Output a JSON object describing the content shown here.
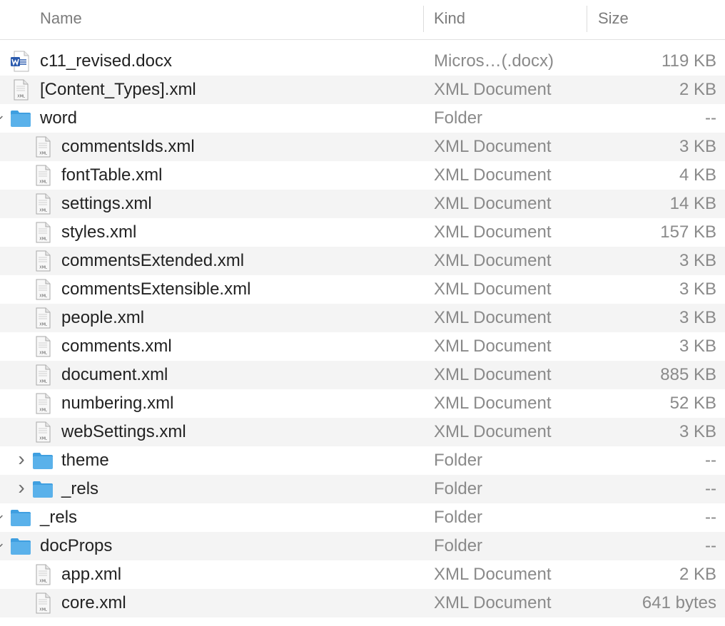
{
  "columns": {
    "name": "Name",
    "kind": "Kind",
    "size": "Size"
  },
  "rows": [
    {
      "name": "c11_revised.docx",
      "kind": "Micros…(.docx)",
      "size": "119 KB",
      "icon": "word-doc-icon",
      "depth": 0,
      "disclosure": "none"
    },
    {
      "name": "[Content_Types].xml",
      "kind": "XML Document",
      "size": "2 KB",
      "icon": "xml-file-icon",
      "depth": 0,
      "disclosure": "none"
    },
    {
      "name": "word",
      "kind": "Folder",
      "size": "--",
      "icon": "folder-icon",
      "depth": 0,
      "disclosure": "expanded"
    },
    {
      "name": "commentsIds.xml",
      "kind": "XML Document",
      "size": "3 KB",
      "icon": "xml-file-icon",
      "depth": 1,
      "disclosure": "none"
    },
    {
      "name": "fontTable.xml",
      "kind": "XML Document",
      "size": "4 KB",
      "icon": "xml-file-icon",
      "depth": 1,
      "disclosure": "none"
    },
    {
      "name": "settings.xml",
      "kind": "XML Document",
      "size": "14 KB",
      "icon": "xml-file-icon",
      "depth": 1,
      "disclosure": "none"
    },
    {
      "name": "styles.xml",
      "kind": "XML Document",
      "size": "157 KB",
      "icon": "xml-file-icon",
      "depth": 1,
      "disclosure": "none"
    },
    {
      "name": "commentsExtended.xml",
      "kind": "XML Document",
      "size": "3 KB",
      "icon": "xml-file-icon",
      "depth": 1,
      "disclosure": "none"
    },
    {
      "name": "commentsExtensible.xml",
      "kind": "XML Document",
      "size": "3 KB",
      "icon": "xml-file-icon",
      "depth": 1,
      "disclosure": "none"
    },
    {
      "name": "people.xml",
      "kind": "XML Document",
      "size": "3 KB",
      "icon": "xml-file-icon",
      "depth": 1,
      "disclosure": "none"
    },
    {
      "name": "comments.xml",
      "kind": "XML Document",
      "size": "3 KB",
      "icon": "xml-file-icon",
      "depth": 1,
      "disclosure": "none"
    },
    {
      "name": "document.xml",
      "kind": "XML Document",
      "size": "885 KB",
      "icon": "xml-file-icon",
      "depth": 1,
      "disclosure": "none"
    },
    {
      "name": "numbering.xml",
      "kind": "XML Document",
      "size": "52 KB",
      "icon": "xml-file-icon",
      "depth": 1,
      "disclosure": "none"
    },
    {
      "name": "webSettings.xml",
      "kind": "XML Document",
      "size": "3 KB",
      "icon": "xml-file-icon",
      "depth": 1,
      "disclosure": "none"
    },
    {
      "name": "theme",
      "kind": "Folder",
      "size": "--",
      "icon": "folder-icon",
      "depth": 1,
      "disclosure": "collapsed"
    },
    {
      "name": "_rels",
      "kind": "Folder",
      "size": "--",
      "icon": "folder-icon",
      "depth": 1,
      "disclosure": "collapsed"
    },
    {
      "name": "_rels",
      "kind": "Folder",
      "size": "--",
      "icon": "folder-icon",
      "depth": 0,
      "disclosure": "expanded"
    },
    {
      "name": "docProps",
      "kind": "Folder",
      "size": "--",
      "icon": "folder-icon",
      "depth": 0,
      "disclosure": "expanded"
    },
    {
      "name": "app.xml",
      "kind": "XML Document",
      "size": "2 KB",
      "icon": "xml-file-icon",
      "depth": 1,
      "disclosure": "none"
    },
    {
      "name": "core.xml",
      "kind": "XML Document",
      "size": "641 bytes",
      "icon": "xml-file-icon",
      "depth": 1,
      "disclosure": "none"
    }
  ],
  "colors": {
    "folder": "#5ab1ea",
    "folder_tab": "#3f9fe0",
    "word_blue": "#2b5aad",
    "alt_row": "#f4f4f4",
    "secondary_text": "#8a8a8a"
  }
}
